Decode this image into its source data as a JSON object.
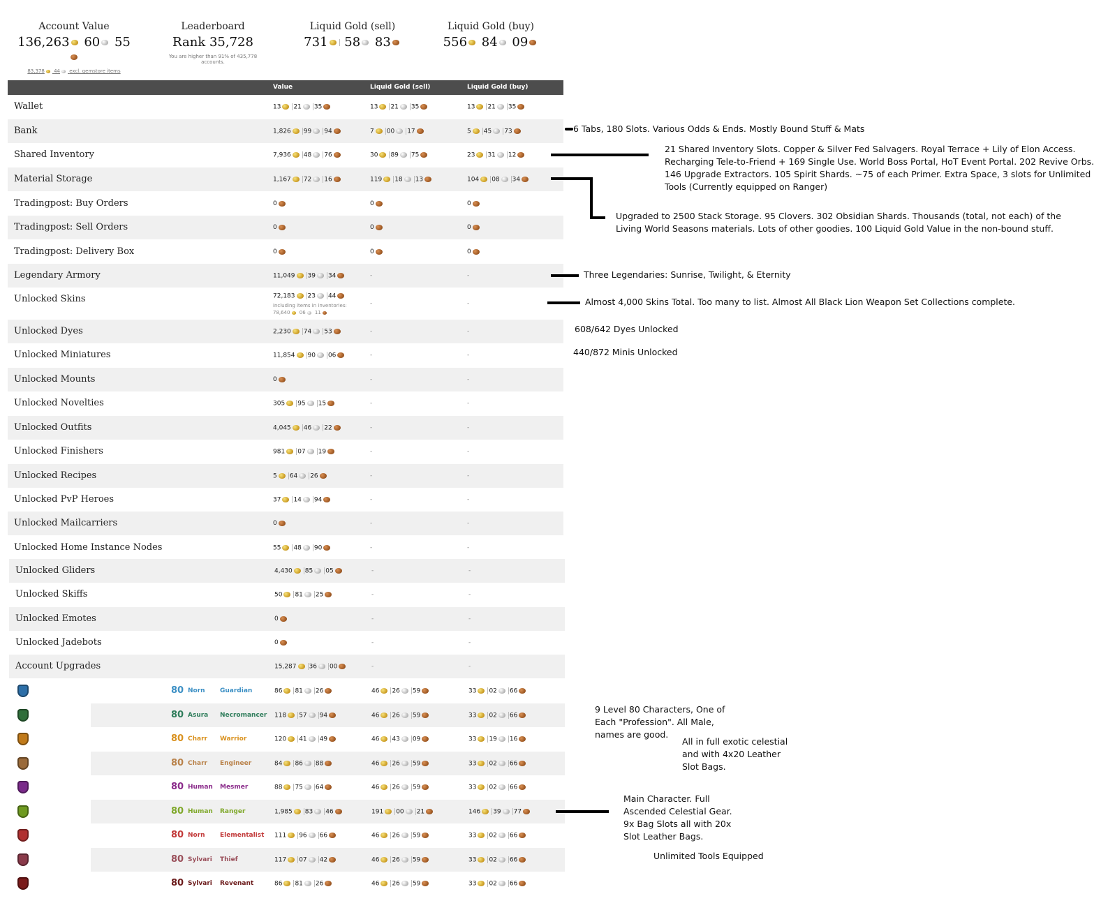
{
  "summary": {
    "account_value": {
      "label": "Account Value",
      "gold": "136,263",
      "silver": "60",
      "copper": "55",
      "sub_gold": "83,378",
      "sub_silver": "44",
      "sub_text": "excl. gemstore items"
    },
    "leaderboard": {
      "label": "Leaderboard",
      "rank": "Rank 35,728",
      "sub": "You are higher than 91% of 435,778 accounts."
    },
    "liquid_sell": {
      "label": "Liquid Gold (sell)",
      "gold": "731",
      "silver": "58",
      "copper": "83"
    },
    "liquid_buy": {
      "label": "Liquid Gold (buy)",
      "gold": "556",
      "silver": "84",
      "copper": "09"
    }
  },
  "table_header": {
    "value": "Value",
    "sell": "Liquid Gold (sell)",
    "buy": "Liquid Gold (buy)"
  },
  "rows": [
    {
      "name": "Wallet",
      "value": {
        "g": "13",
        "s": "21",
        "c": "35"
      },
      "sell": {
        "g": "13",
        "s": "21",
        "c": "35"
      },
      "buy": {
        "g": "13",
        "s": "21",
        "c": "35"
      }
    },
    {
      "name": "Bank",
      "value": {
        "g": "1,826",
        "s": "99",
        "c": "94"
      },
      "sell": {
        "g": "7",
        "s": "00",
        "c": "17"
      },
      "buy": {
        "g": "5",
        "s": "45",
        "c": "73"
      }
    },
    {
      "name": "Shared Inventory",
      "value": {
        "g": "7,936",
        "s": "48",
        "c": "76"
      },
      "sell": {
        "g": "30",
        "s": "89",
        "c": "75"
      },
      "buy": {
        "g": "23",
        "s": "31",
        "c": "12"
      }
    },
    {
      "name": "Material Storage",
      "value": {
        "g": "1,167",
        "s": "72",
        "c": "16"
      },
      "sell": {
        "g": "119",
        "s": "18",
        "c": "13"
      },
      "buy": {
        "g": "104",
        "s": "08",
        "c": "34"
      }
    },
    {
      "name": "Tradingpost: Buy Orders",
      "value": {
        "c": "0"
      },
      "sell": {
        "c": "0"
      },
      "buy": {
        "c": "0"
      }
    },
    {
      "name": "Tradingpost: Sell Orders",
      "value": {
        "c": "0"
      },
      "sell": {
        "c": "0"
      },
      "buy": {
        "c": "0"
      }
    },
    {
      "name": "Tradingpost: Delivery Box",
      "value": {
        "c": "0"
      },
      "sell": {
        "c": "0"
      },
      "buy": {
        "c": "0"
      }
    },
    {
      "name": "Legendary Armory",
      "value": {
        "g": "11,049",
        "s": "39",
        "c": "34"
      },
      "sell": "-",
      "buy": "-"
    },
    {
      "name": "Unlocked Skins",
      "value": {
        "g": "72,183",
        "s": "23",
        "c": "44"
      },
      "note1": "including items in inventories:",
      "note2": {
        "g": "78,640",
        "s": "06",
        "c": "11"
      },
      "sell": "-",
      "buy": "-"
    },
    {
      "name": "Unlocked Dyes",
      "value": {
        "g": "2,230",
        "s": "74",
        "c": "53"
      },
      "sell": "-",
      "buy": "-"
    },
    {
      "name": "Unlocked Miniatures",
      "value": {
        "g": "11,854",
        "s": "90",
        "c": "06"
      },
      "sell": "-",
      "buy": "-"
    },
    {
      "name": "Unlocked Mounts",
      "value": {
        "c": "0"
      },
      "sell": "-",
      "buy": "-"
    },
    {
      "name": "Unlocked Novelties",
      "value": {
        "g": "305",
        "s": "95",
        "c": "15"
      },
      "sell": "-",
      "buy": "-"
    },
    {
      "name": "Unlocked Outfits",
      "value": {
        "g": "4,045",
        "s": "46",
        "c": "22"
      },
      "sell": "-",
      "buy": "-"
    },
    {
      "name": "Unlocked Finishers",
      "value": {
        "g": "981",
        "s": "07",
        "c": "19"
      },
      "sell": "-",
      "buy": "-"
    },
    {
      "name": "Unlocked Recipes",
      "value": {
        "g": "5",
        "s": "64",
        "c": "26"
      },
      "sell": "-",
      "buy": "-"
    },
    {
      "name": "Unlocked PvP Heroes",
      "value": {
        "g": "37",
        "s": "14",
        "c": "94"
      },
      "sell": "-",
      "buy": "-"
    },
    {
      "name": "Unlocked Mailcarriers",
      "value": {
        "c": "0"
      },
      "sell": "-",
      "buy": "-"
    },
    {
      "name": "Unlocked Home Instance Nodes",
      "value": {
        "g": "55",
        "s": "48",
        "c": "90"
      },
      "sell": "-",
      "buy": "-"
    },
    {
      "name": "Unlocked Gliders",
      "value": {
        "g": "4,430",
        "s": "85",
        "c": "05"
      },
      "sell": "-",
      "buy": "-"
    },
    {
      "name": "Unlocked Skiffs",
      "value": {
        "g": "50",
        "s": "81",
        "c": "25"
      },
      "sell": "-",
      "buy": "-"
    },
    {
      "name": "Unlocked Emotes",
      "value": {
        "c": "0"
      },
      "sell": "-",
      "buy": "-"
    },
    {
      "name": "Unlocked Jadebots",
      "value": {
        "c": "0"
      },
      "sell": "-",
      "buy": "-"
    },
    {
      "name": "Account Upgrades",
      "value": {
        "g": "15,287",
        "s": "36",
        "c": "00"
      },
      "sell": "-",
      "buy": "-"
    }
  ],
  "characters": [
    {
      "level": "80",
      "race": "Norn",
      "profession": "Guardian",
      "color": "#3b8fc4",
      "icon": "guardian-icon",
      "icolor": "#2d6fa8",
      "value": {
        "g": "86",
        "s": "81",
        "c": "26"
      },
      "sell": {
        "g": "46",
        "s": "26",
        "c": "59"
      },
      "buy": {
        "g": "33",
        "s": "02",
        "c": "66"
      }
    },
    {
      "level": "80",
      "race": "Asura",
      "profession": "Necromancer",
      "color": "#2f7d5b",
      "icon": "necromancer-icon",
      "icolor": "#2f6e3a",
      "value": {
        "g": "118",
        "s": "57",
        "c": "94"
      },
      "sell": {
        "g": "46",
        "s": "26",
        "c": "59"
      },
      "buy": {
        "g": "33",
        "s": "02",
        "c": "66"
      }
    },
    {
      "level": "80",
      "race": "Charr",
      "profession": "Warrior",
      "color": "#d9911e",
      "icon": "warrior-icon",
      "icolor": "#c07a1a",
      "value": {
        "g": "120",
        "s": "41",
        "c": "49"
      },
      "sell": {
        "g": "46",
        "s": "43",
        "c": "09"
      },
      "buy": {
        "g": "33",
        "s": "19",
        "c": "16"
      }
    },
    {
      "level": "80",
      "race": "Charr",
      "profession": "Engineer",
      "color": "#b9824a",
      "icon": "engineer-icon",
      "icolor": "#9a6a3a",
      "value": {
        "g": "84",
        "s": "86",
        "c": "88"
      },
      "sell": {
        "g": "46",
        "s": "26",
        "c": "59"
      },
      "buy": {
        "g": "33",
        "s": "02",
        "c": "66"
      }
    },
    {
      "level": "80",
      "race": "Human",
      "profession": "Mesmer",
      "color": "#8a2a8a",
      "icon": "mesmer-icon",
      "icolor": "#7a2a8a",
      "value": {
        "g": "88",
        "s": "75",
        "c": "64"
      },
      "sell": {
        "g": "46",
        "s": "26",
        "c": "59"
      },
      "buy": {
        "g": "33",
        "s": "02",
        "c": "66"
      }
    },
    {
      "level": "80",
      "race": "Human",
      "profession": "Ranger",
      "color": "#7fa82a",
      "icon": "ranger-icon",
      "icolor": "#6e9a20",
      "value": {
        "g": "1,985",
        "s": "83",
        "c": "46"
      },
      "sell": {
        "g": "191",
        "s": "00",
        "c": "21"
      },
      "buy": {
        "g": "146",
        "s": "39",
        "c": "77"
      }
    },
    {
      "level": "80",
      "race": "Norn",
      "profession": "Elementalist",
      "color": "#c23a3a",
      "icon": "elementalist-icon",
      "icolor": "#b03030",
      "value": {
        "g": "111",
        "s": "96",
        "c": "66"
      },
      "sell": {
        "g": "46",
        "s": "26",
        "c": "59"
      },
      "buy": {
        "g": "33",
        "s": "02",
        "c": "66"
      }
    },
    {
      "level": "80",
      "race": "Sylvari",
      "profession": "Thief",
      "color": "#9a4f5a",
      "icon": "thief-icon",
      "icolor": "#8a3a4a",
      "value": {
        "g": "117",
        "s": "07",
        "c": "42"
      },
      "sell": {
        "g": "46",
        "s": "26",
        "c": "59"
      },
      "buy": {
        "g": "33",
        "s": "02",
        "c": "66"
      }
    },
    {
      "level": "80",
      "race": "Sylvari",
      "profession": "Revenant",
      "color": "#6b1a1a",
      "icon": "revenant-icon",
      "icolor": "#7a1a1a",
      "value": {
        "g": "86",
        "s": "81",
        "c": "26"
      },
      "sell": {
        "g": "46",
        "s": "26",
        "c": "59"
      },
      "buy": {
        "g": "33",
        "s": "02",
        "c": "66"
      }
    }
  ],
  "annotations": {
    "bank": "6 Tabs, 180 Slots. Various Odds & Ends. Mostly Bound Stuff & Mats",
    "shared": [
      "21 Shared Inventory Slots. Copper & Silver Fed Salvagers. Royal Terrace + Lily of Elon Access.",
      "Recharging Tele-to-Friend + 169 Single Use. World Boss Portal, HoT Event Portal. 202 Revive Orbs.",
      "146 Upgrade Extractors. 105 Spirit Shards. ~75 of each Primer. Extra Space, 3 slots for Unlimited",
      "Tools (Currently equipped on Ranger)"
    ],
    "material": [
      "Upgraded to 2500 Stack Storage. 95 Clovers. 302 Obsidian Shards. Thousands (total, not each) of the",
      "Living World Seasons materials. Lots of other goodies. 100 Liquid Gold Value in the non-bound stuff."
    ],
    "legendary": "Three Legendaries: Sunrise, Twilight, & Eternity",
    "skins": "Almost 4,000 Skins Total. Too many to list. Almost All Black Lion Weapon Set Collections complete.",
    "dyes": "608/642 Dyes Unlocked",
    "minis": "440/872 Minis Unlocked",
    "chars": [
      "9 Level 80 Characters, One of",
      "Each \"Profession\". All Male,",
      "names are good."
    ],
    "exotic": [
      "All in full exotic celestial",
      "and with 4x20 Leather",
      "Slot Bags."
    ],
    "main": [
      "Main Character. Full",
      "Ascended Celestial Gear.",
      "9x Bag Slots all with 20x",
      "Slot Leather Bags."
    ],
    "tools": "Unlimited Tools Equipped"
  }
}
